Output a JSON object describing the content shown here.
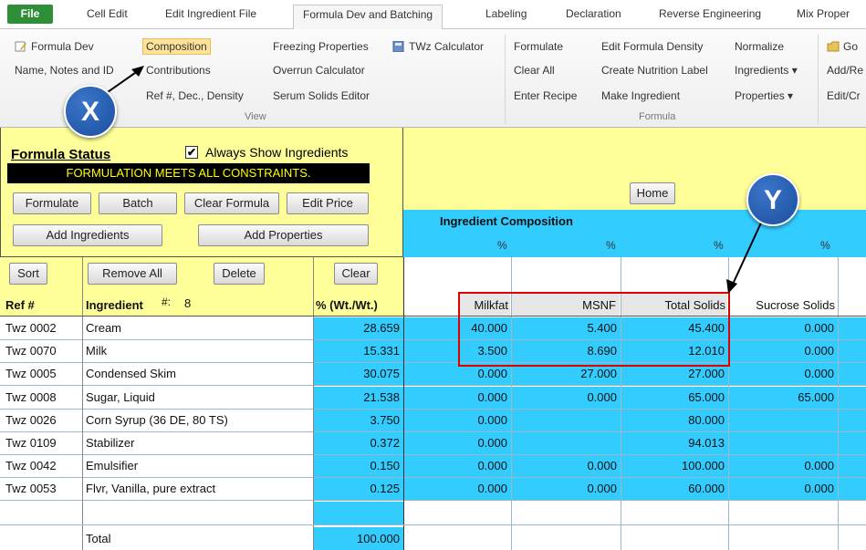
{
  "tabs": {
    "file": "File",
    "cell_edit": "Cell Edit",
    "edit_ingredient_file": "Edit Ingredient File",
    "formula_dev": "Formula Dev and Batching",
    "labeling": "Labeling",
    "declaration": "Declaration",
    "reverse_engineering": "Reverse Engineering",
    "mix_properties": "Mix Proper"
  },
  "ribbon": {
    "view": {
      "formula_dev": "Formula Dev",
      "composition": "Composition",
      "freezing_properties": "Freezing Properties",
      "twz_calculator": "TWz Calculator",
      "name_notes": "Name, Notes and ID",
      "contributions": "Contributions",
      "overrun_calculator": "Overrun Calculator",
      "ref_dec_density": "Ref #, Dec., Density",
      "serum_solids_editor": "Serum Solids Editor",
      "group_label": "View"
    },
    "formula": {
      "formulate": "Formulate",
      "clear_all": "Clear All",
      "enter_recipe": "Enter Recipe",
      "edit_formula_density": "Edit Formula Density",
      "create_nutrition_label": "Create Nutrition Label",
      "make_ingredient": "Make Ingredient",
      "normalize": "Normalize",
      "ingredients": "Ingredients ▾",
      "properties": "Properties ▾",
      "group_label": "Formula"
    },
    "extra": {
      "go": "Go",
      "add_re": "Add/Re",
      "edit_cr": "Edit/Cr"
    }
  },
  "callouts": {
    "x": "X",
    "y": "Y"
  },
  "status": {
    "title": "Formula Status",
    "always_show_label": "Always Show Ingredients",
    "always_show_checked": true,
    "message": "FORMULATION MEETS ALL CONSTRAINTS.",
    "buttons": {
      "formulate": "Formulate",
      "batch": "Batch",
      "clear_formula": "Clear Formula",
      "edit_price": "Edit Price",
      "add_ingredients": "Add Ingredients",
      "add_properties": "Add Properties"
    }
  },
  "composition": {
    "home": "Home",
    "title": "Ingredient Composition",
    "pct_symbol": "%"
  },
  "table": {
    "sort": "Sort",
    "remove_all": "Remove All",
    "delete": "Delete",
    "clear": "Clear",
    "col_ref": "Ref #",
    "col_ingredient": "Ingredient",
    "count_label": "#:",
    "count": "8",
    "col_wt": "% (Wt./Wt.)",
    "col_milkfat": "Milkfat",
    "col_msnf": "MSNF",
    "col_total_solids": "Total Solids",
    "col_sucrose_solids": "Sucrose Solids",
    "rows": [
      {
        "ref": "Twz 0002",
        "name": "Cream",
        "wt": "28.659",
        "milkfat": "40.000",
        "msnf": "5.400",
        "ts": "45.400",
        "ss": "0.000"
      },
      {
        "ref": "Twz 0070",
        "name": "Milk",
        "wt": "15.331",
        "milkfat": "3.500",
        "msnf": "8.690",
        "ts": "12.010",
        "ss": "0.000"
      },
      {
        "ref": "Twz 0005",
        "name": "Condensed Skim",
        "wt": "30.075",
        "milkfat": "0.000",
        "msnf": "27.000",
        "ts": "27.000",
        "ss": "0.000"
      },
      {
        "ref": "Twz 0008",
        "name": "Sugar, Liquid",
        "wt": "21.538",
        "milkfat": "0.000",
        "msnf": "0.000",
        "ts": "65.000",
        "ss": "65.000"
      },
      {
        "ref": "Twz 0026",
        "name": "Corn Syrup (36 DE, 80 TS)",
        "wt": "3.750",
        "milkfat": "0.000",
        "msnf": "",
        "ts": "80.000",
        "ss": ""
      },
      {
        "ref": "Twz 0109",
        "name": "Stabilizer",
        "wt": "0.372",
        "milkfat": "0.000",
        "msnf": "",
        "ts": "94.013",
        "ss": ""
      },
      {
        "ref": "Twz 0042",
        "name": "Emulsifier",
        "wt": "0.150",
        "milkfat": "0.000",
        "msnf": "0.000",
        "ts": "100.000",
        "ss": "0.000"
      },
      {
        "ref": "Twz 0053",
        "name": "Flvr, Vanilla, pure extract",
        "wt": "0.125",
        "milkfat": "0.000",
        "msnf": "0.000",
        "ts": "60.000",
        "ss": "0.000"
      }
    ],
    "total_label": "Total",
    "total_value": "100.000"
  },
  "colors": {
    "cyan": "#33ccff",
    "yellow_panel": "#ffff99",
    "highlight_red": "#e00000",
    "callout_blue": "#1c4f9f"
  }
}
